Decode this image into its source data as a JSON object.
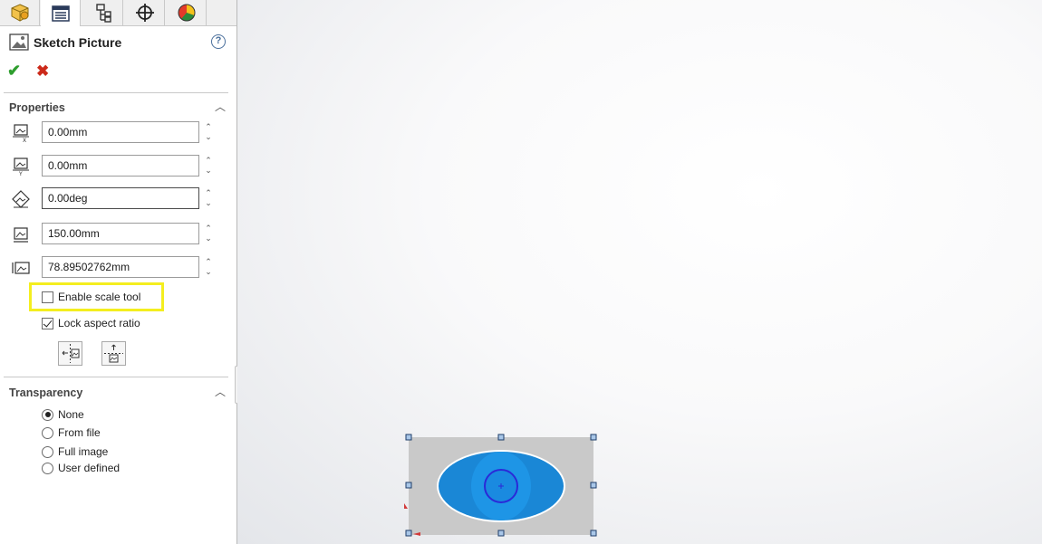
{
  "panel": {
    "title": "Sketch Picture",
    "help_label": "?",
    "ok_label": "✔",
    "cancel_label": "✖"
  },
  "tabs": [
    {
      "name": "feature-manager",
      "icon": "cube-icon"
    },
    {
      "name": "property-manager",
      "icon": "properties-list-icon"
    },
    {
      "name": "configuration-manager",
      "icon": "configuration-icon"
    },
    {
      "name": "dimxpert-manager",
      "icon": "crosshair-icon"
    },
    {
      "name": "display-manager",
      "icon": "appearance-icon"
    }
  ],
  "properties": {
    "title": "Properties",
    "collapse_label": "︿",
    "x_position": "0.00mm",
    "y_position": "0.00mm",
    "angle": "0.00deg",
    "width": "150.00mm",
    "height": "78.89502762mm",
    "enable_scale_tool_label": "Enable scale tool",
    "lock_aspect_ratio_label": "Lock aspect ratio",
    "enable_scale_tool_checked": false,
    "lock_aspect_ratio_checked": true
  },
  "transparency": {
    "title": "Transparency",
    "collapse_label": "︿",
    "options": [
      "None",
      "From file",
      "Full image",
      "User defined"
    ],
    "selected": "None"
  },
  "colors": {
    "accent_highlight": "#f4ee1f",
    "ok_green": "#2e9e2e",
    "cancel_red": "#cc2a1a",
    "model_blue": "#1a87d6",
    "picture_bg": "#c9c9c9"
  }
}
